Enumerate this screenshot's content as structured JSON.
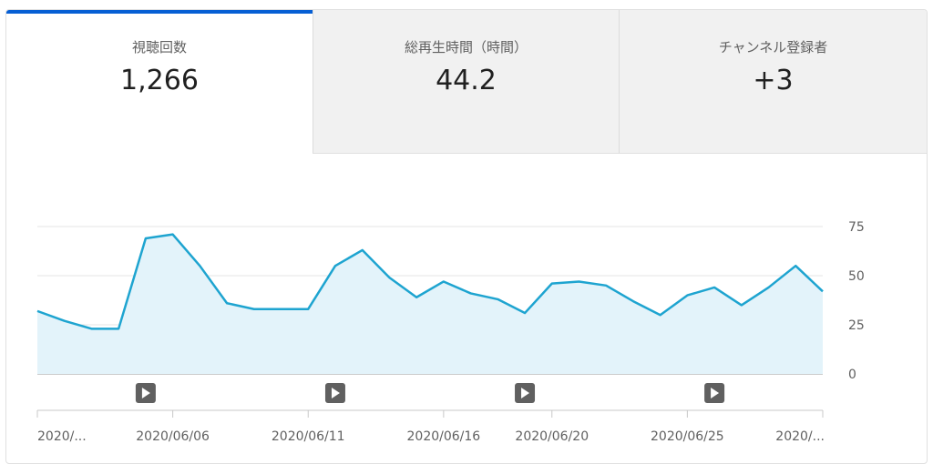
{
  "tabs": [
    {
      "label": "視聴回数",
      "value": "1,266",
      "active": true
    },
    {
      "label": "総再生時間（時間）",
      "value": "44.2",
      "active": false
    },
    {
      "label": "チャンネル登録者",
      "value": "+3",
      "active": false
    }
  ],
  "colors": {
    "accent": "#065fd4",
    "line": "#1ea4d0",
    "fill": "#e3f3fa",
    "grid": "#e6e6e6",
    "axis": "#999999",
    "marker": "#606060",
    "tick_text": "#606060"
  },
  "chart_data": {
    "type": "area",
    "x": [
      "2020/06/02",
      "2020/06/03",
      "2020/06/04",
      "2020/06/05",
      "2020/06/06",
      "2020/06/07",
      "2020/06/08",
      "2020/06/09",
      "2020/06/10",
      "2020/06/11",
      "2020/06/12",
      "2020/06/13",
      "2020/06/14",
      "2020/06/15",
      "2020/06/16",
      "2020/06/17",
      "2020/06/18",
      "2020/06/19",
      "2020/06/20",
      "2020/06/21",
      "2020/06/22",
      "2020/06/23",
      "2020/06/24",
      "2020/06/25",
      "2020/06/26",
      "2020/06/27",
      "2020/06/28",
      "2020/06/29",
      "2020/06/30",
      "2020/07/01"
    ],
    "values": [
      32,
      27,
      23,
      23,
      69,
      71,
      55,
      36,
      33,
      33,
      33,
      55,
      63,
      49,
      39,
      47,
      41,
      38,
      31,
      46,
      47,
      45,
      37,
      30,
      40,
      44,
      35,
      44,
      55,
      42
    ],
    "ylim": [
      0,
      75
    ],
    "yticks": [
      "0",
      "25",
      "50",
      "75"
    ],
    "ytick_values": [
      0,
      25,
      50,
      75
    ],
    "xtick_labels": [
      {
        "text": "2020/...",
        "index": 0
      },
      {
        "text": "2020/06/06",
        "index": 5
      },
      {
        "text": "2020/06/11",
        "index": 10
      },
      {
        "text": "2020/06/16",
        "index": 15
      },
      {
        "text": "2020/06/20",
        "index": 19
      },
      {
        "text": "2020/06/25",
        "index": 24
      },
      {
        "text": "2020/...",
        "index": 29
      }
    ],
    "video_markers": [
      4,
      11,
      18,
      25
    ],
    "grid": true
  }
}
